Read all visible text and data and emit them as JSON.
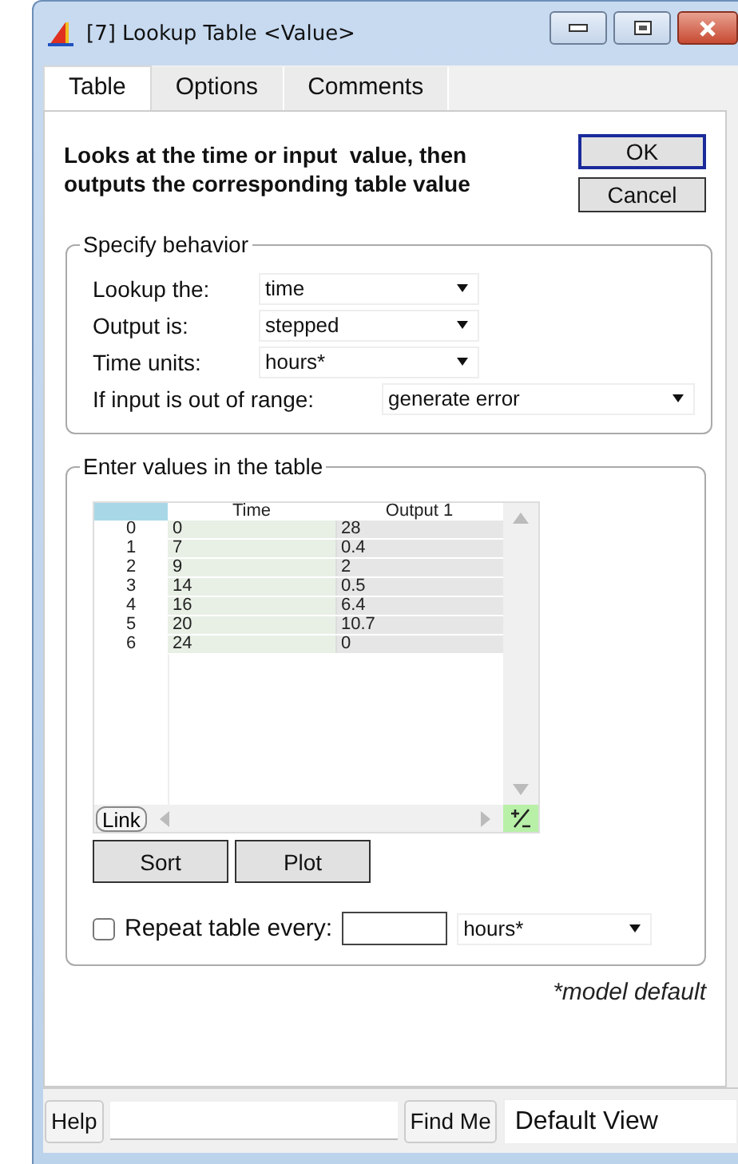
{
  "window": {
    "title": "[7] Lookup Table <Value>"
  },
  "tabs": [
    {
      "label": "Table",
      "selected": true
    },
    {
      "label": "Options",
      "selected": false
    },
    {
      "label": "Comments",
      "selected": false
    }
  ],
  "description": "Looks at the time or input  value, then outputs the corresponding table value",
  "buttons": [
    {
      "label": "OK",
      "default": true
    },
    {
      "label": "Cancel",
      "default": false
    }
  ],
  "behavior": {
    "title": "Specify behavior",
    "fields": [
      {
        "label": "Lookup the:",
        "value": "time"
      },
      {
        "label": "Output is:",
        "value": "stepped"
      },
      {
        "label": "Time units:",
        "value": "hours*"
      },
      {
        "label": "If input is out of range:",
        "value": "generate error"
      }
    ]
  },
  "table_section": {
    "title": "Enter values in the table",
    "columns": [
      "Time",
      "Output 1"
    ],
    "rows": [
      {
        "index": "0",
        "cells": [
          "0",
          "28"
        ]
      },
      {
        "index": "1",
        "cells": [
          "7",
          "0.4"
        ]
      },
      {
        "index": "2",
        "cells": [
          "9",
          "2"
        ]
      },
      {
        "index": "3",
        "cells": [
          "14",
          "0.5"
        ]
      },
      {
        "index": "4",
        "cells": [
          "16",
          "6.4"
        ]
      },
      {
        "index": "5",
        "cells": [
          "20",
          "10.7"
        ]
      },
      {
        "index": "6",
        "cells": [
          "24",
          "0"
        ]
      }
    ],
    "link": "Link",
    "actions": [
      "Sort",
      "Plot"
    ],
    "repeat": {
      "checked": false,
      "label": "Repeat table every:",
      "units": "hours*"
    }
  },
  "footnote": "*model default",
  "bottom_bar": {
    "help": "Help",
    "find": "Find Me",
    "view": "Default View"
  }
}
